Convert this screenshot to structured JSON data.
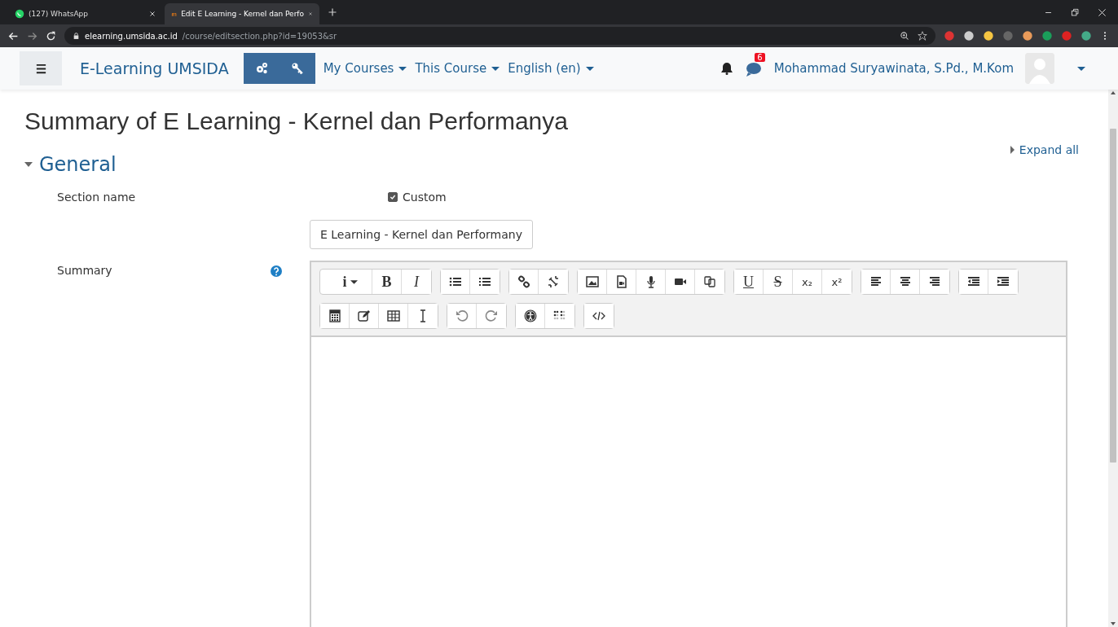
{
  "browser": {
    "tabs": [
      {
        "title": "(127) WhatsApp",
        "kind": "chat",
        "selected": false
      },
      {
        "title": "Edit E Learning - Kernel dan Perfo",
        "kind": "moodle",
        "selected": true
      }
    ],
    "address": {
      "host": "elearning.umsida.ac.id",
      "path": "/course/editsection.php?id=19053&sr"
    }
  },
  "navbar": {
    "site_name": "E-Learning UMSIDA",
    "menus": [
      "My Courses",
      "This Course",
      "English (en)"
    ],
    "message_count": "6",
    "user_name": "Mohammad Suryawinata, S.Pd., M.Kom"
  },
  "page_title": "Summary of E Learning - Kernel dan Performanya",
  "expand_all": "Expand all",
  "section": {
    "title": "General",
    "expanded": true
  },
  "section_name": {
    "label": "Section name",
    "custom": {
      "label": "Custom",
      "checked": true
    },
    "value": "E Learning - Kernel dan Performany"
  },
  "summary": {
    "label": "Summary",
    "toolbar": [
      [
        [
          {
            "kind": "menu",
            "label": "i"
          },
          {
            "kind": "bold",
            "label": "B"
          },
          {
            "kind": "italic",
            "label": "I"
          }
        ],
        [
          {
            "kind": "bullet-list"
          },
          {
            "kind": "numbered-list"
          }
        ],
        [
          {
            "kind": "link"
          },
          {
            "kind": "unlink"
          }
        ],
        [
          {
            "kind": "image"
          },
          {
            "kind": "media"
          },
          {
            "kind": "microphone"
          },
          {
            "kind": "video"
          },
          {
            "kind": "copy"
          }
        ],
        [
          {
            "kind": "underline",
            "label": "U"
          },
          {
            "kind": "strike",
            "label": "S"
          },
          {
            "kind": "sub",
            "label": "x₂"
          },
          {
            "kind": "sup",
            "label": "x²"
          }
        ],
        [
          {
            "kind": "align-left"
          },
          {
            "kind": "align-center"
          },
          {
            "kind": "align-right"
          }
        ],
        [
          {
            "kind": "outdent"
          },
          {
            "kind": "indent"
          }
        ]
      ],
      [
        [
          {
            "kind": "calculator"
          },
          {
            "kind": "edit"
          },
          {
            "kind": "table"
          },
          {
            "kind": "text-cursor"
          }
        ],
        [
          {
            "kind": "undo"
          },
          {
            "kind": "redo"
          }
        ],
        [
          {
            "kind": "accessibility"
          },
          {
            "kind": "braille"
          }
        ],
        [
          {
            "kind": "code"
          }
        ]
      ]
    ]
  }
}
